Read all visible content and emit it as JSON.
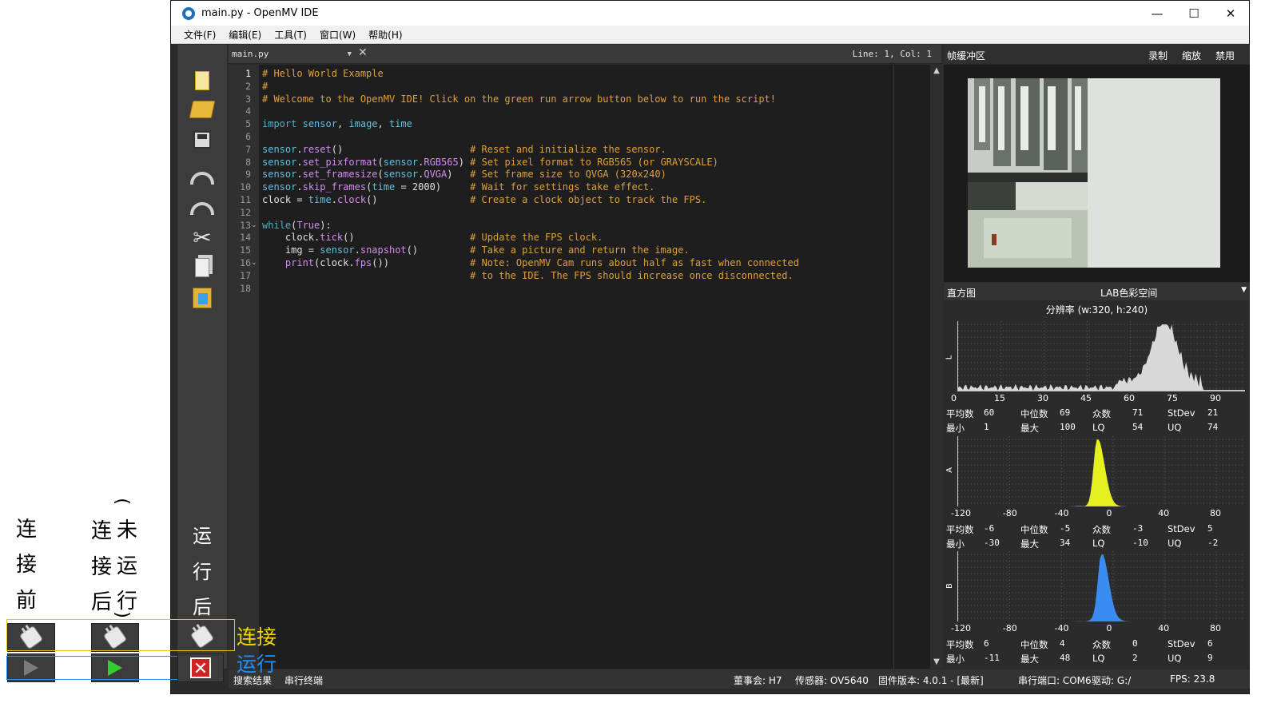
{
  "window": {
    "title": "main.py - OpenMV IDE",
    "controls": [
      "—",
      "☐",
      "✕"
    ]
  },
  "menu": [
    "文件(F)",
    "编辑(E)",
    "工具(T)",
    "窗口(W)",
    "帮助(H)"
  ],
  "editor": {
    "file": "main.py",
    "position": "Line: 1, Col: 1",
    "lines": [
      "# Hello World Example",
      "#",
      "# Welcome to the OpenMV IDE! Click on the green run arrow button below to run the script!",
      "",
      "import sensor, image, time",
      "",
      "sensor.reset()                      # Reset and initialize the sensor.",
      "sensor.set_pixformat(sensor.RGB565) # Set pixel format to RGB565 (or GRAYSCALE)",
      "sensor.set_framesize(sensor.QVGA)   # Set frame size to QVGA (320x240)",
      "sensor.skip_frames(time = 2000)     # Wait for settings take effect.",
      "clock = time.clock()                # Create a clock object to track the FPS.",
      "",
      "while(True):",
      "    clock.tick()                    # Update the FPS clock.",
      "    img = sensor.snapshot()         # Take a picture and return the image.",
      "    print(clock.fps())              # Note: OpenMV Cam runs about half as fast when connected",
      "                                    # to the IDE. The FPS should increase once disconnected.",
      ""
    ]
  },
  "toolbar": {
    "icons": [
      "new-file-icon",
      "open-folder-icon",
      "save-icon",
      "undo-icon",
      "redo-icon",
      "cut-icon",
      "copy-icon",
      "paste-icon"
    ],
    "run_label": [
      "运",
      "行",
      "后"
    ]
  },
  "framebuffer": {
    "title": "帧缓冲区",
    "buttons": [
      "录制",
      "缩放",
      "禁用"
    ]
  },
  "histogram": {
    "title": "直方图",
    "colorspace": "LAB色彩空间",
    "resolution": "分辨率 (w:320, h:240)",
    "channels": [
      {
        "name": "L",
        "ticks": [
          "0",
          "15",
          "30",
          "45",
          "60",
          "75",
          "90"
        ],
        "stats": {
          "平均数": "60",
          "中位数": "69",
          "众数": "71",
          "StDev": "21",
          "最小": "1",
          "最大": "100",
          "LQ": "54",
          "UQ": "74"
        },
        "color": "#d8d8d8"
      },
      {
        "name": "A",
        "ticks": [
          "-120",
          "-80",
          "-40",
          "0",
          "40",
          "80"
        ],
        "stats": {
          "平均数": "-6",
          "中位数": "-5",
          "众数": "-3",
          "StDev": "5",
          "最小": "-30",
          "最大": "34",
          "LQ": "-10",
          "UQ": "-2"
        },
        "color": "#e6f020"
      },
      {
        "name": "B",
        "ticks": [
          "-120",
          "-80",
          "-40",
          "0",
          "40",
          "80"
        ],
        "stats": {
          "平均数": "6",
          "中位数": "4",
          "众数": "0",
          "StDev": "6",
          "最小": "-11",
          "最大": "48",
          "LQ": "2",
          "UQ": "9"
        },
        "color": "#3a8cf0"
      }
    ]
  },
  "status": {
    "search": "搜索结果",
    "serial_terminal": "串行终端",
    "board": "董事会: H7",
    "sensor": "传感器: OV5640",
    "firmware": "固件版本: 4.0.1 - [最新]",
    "port": "串行端口: COM6",
    "drive": "驱动: G:/",
    "fps": "FPS:  23.8"
  },
  "annotations": {
    "before_connect": [
      "连",
      "接",
      "前"
    ],
    "after_connect": [
      "连",
      "接",
      "后"
    ],
    "not_running": [
      "(",
      "未",
      "运",
      "行",
      ")"
    ],
    "legend_connect": "连接",
    "legend_run": "运行",
    "colors": {
      "connect": "#f0d800",
      "run": "#1e90ff"
    }
  }
}
